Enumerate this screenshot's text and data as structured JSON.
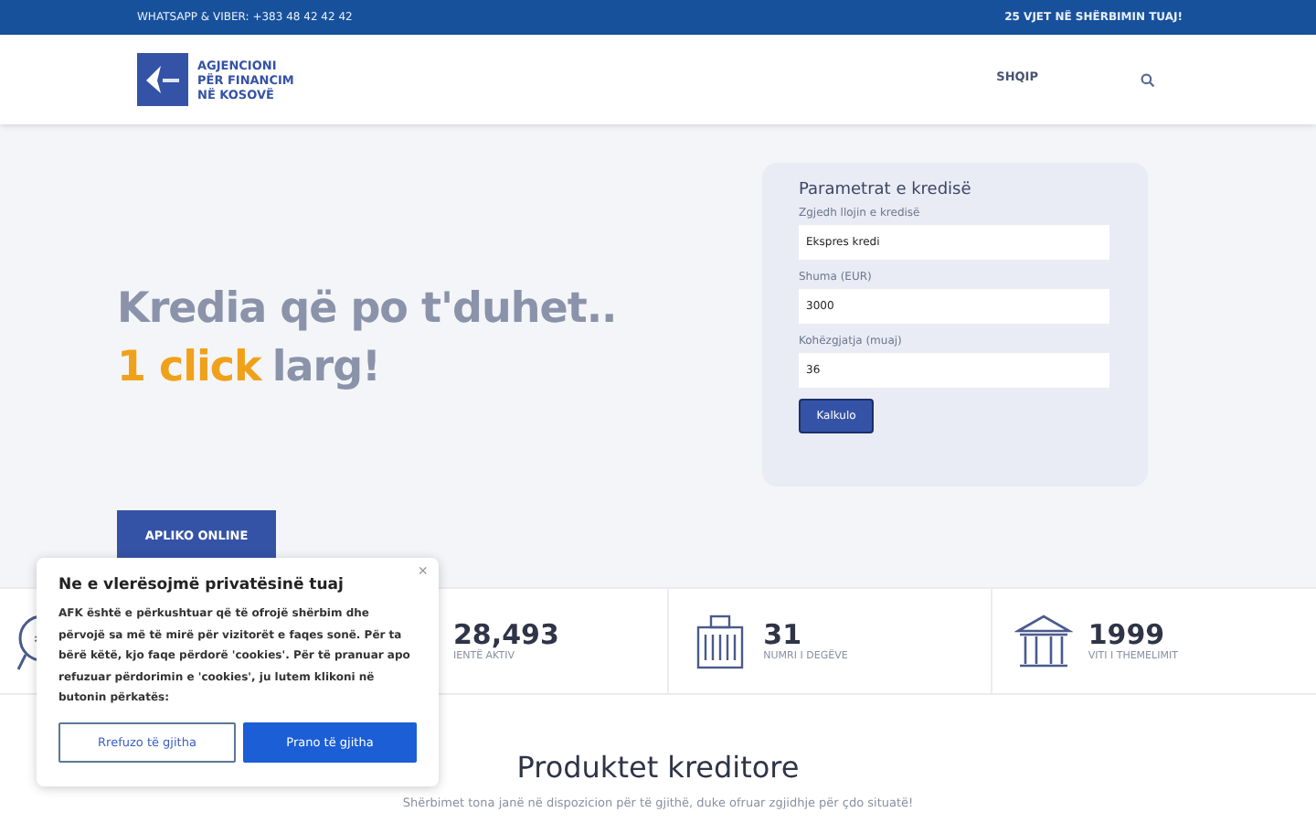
{
  "topbar": {
    "contact": "WHATSAPP & VIBER: +383 48 42 42 42",
    "slogan": "25 VJET NË SHËRBIMIN TUAJ!"
  },
  "header": {
    "logo_lines": [
      "AGJENCIONI",
      "PËR FINANCIM",
      "NË KOSOVË"
    ],
    "language": "SHQIP"
  },
  "hero": {
    "title": "Kredia që po t'duhet..",
    "highlight": "1 click",
    "title_rest": "larg!",
    "button": "APLIKO ONLINE"
  },
  "calculator": {
    "title": "Parametrat e kredisë",
    "fields": [
      {
        "label": "Zgjedh llojin e kredisë",
        "value": "Ekspres kredi"
      },
      {
        "label": "Shuma (EUR)",
        "value": "3000"
      },
      {
        "label": "Kohëzgjatja (muaj)",
        "value": "36"
      }
    ],
    "button": "Kalkulo"
  },
  "stats": [
    {
      "value": "28,493",
      "label": "IENTË AKTIV"
    },
    {
      "value": "31",
      "label": "NUMRI I DEGËVE"
    },
    {
      "value": "1999",
      "label": "VITI I THEMELIMIT"
    }
  ],
  "products": {
    "title": "Produktet kreditore",
    "subtitle": "Shërbimet tona janë në dispozicion për të gjithë, duke ofruar zgjidhje për çdo situatë!"
  },
  "cookie": {
    "title": "Ne e vlerësojmë privatësinë tuaj",
    "text": "AFK është e përkushtuar që të ofrojë shërbim dhe përvojë sa më të mirë për vizitorët e faqes sonë. Për ta bërë këtë, kjo faqe përdorë 'cookies'. Për të pranuar apo refuzuar përdorimin e 'cookies', ju lutem klikoni në butonin përkatës:",
    "close": "×",
    "buttons": [
      {
        "label": "Rrefuzo të gjitha",
        "kind": "outline"
      },
      {
        "label": "Prano të gjitha",
        "kind": "primary"
      }
    ]
  }
}
